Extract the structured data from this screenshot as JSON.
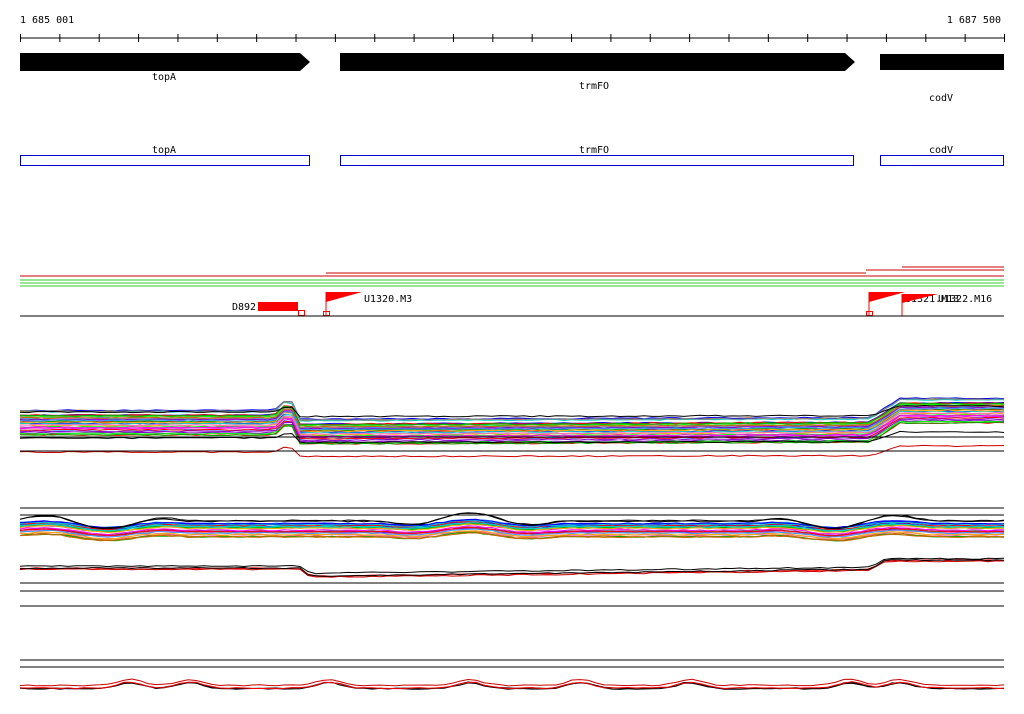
{
  "ruler": {
    "start_label": "1 685 001",
    "end_label": "1 687 500",
    "start": 1685001,
    "end": 1687500
  },
  "colors": {
    "gene_arrow": "#000000",
    "cds_box": "#0000cc",
    "feature_red": "#ff0000",
    "track_line": "#000000",
    "green_line": "#33cc33"
  },
  "genes": [
    {
      "name": "topA",
      "label": "topA",
      "strand": "+"
    },
    {
      "name": "trmFO",
      "label": "trmFO",
      "strand": "+"
    },
    {
      "name": "codV",
      "label": "codV",
      "strand": "+"
    }
  ],
  "cds_boxes": [
    {
      "label": "topA"
    },
    {
      "label": "trmFO"
    },
    {
      "label": "codV"
    }
  ],
  "features": [
    {
      "label": "D892",
      "kind": "block"
    },
    {
      "label": "U1320.M3",
      "kind": "flag"
    },
    {
      "label": "U1321.M13",
      "kind": "flag"
    },
    {
      "label": "U1322.M16",
      "kind": "flag"
    }
  ],
  "signal_palette": [
    "#ff0000",
    "#00aa00",
    "#0000ff",
    "#ff00ff",
    "#00cccc",
    "#ffaa00",
    "#8800cc",
    "#888888",
    "#00ff00",
    "#cc6600",
    "#ff66cc",
    "#3399ff"
  ]
}
